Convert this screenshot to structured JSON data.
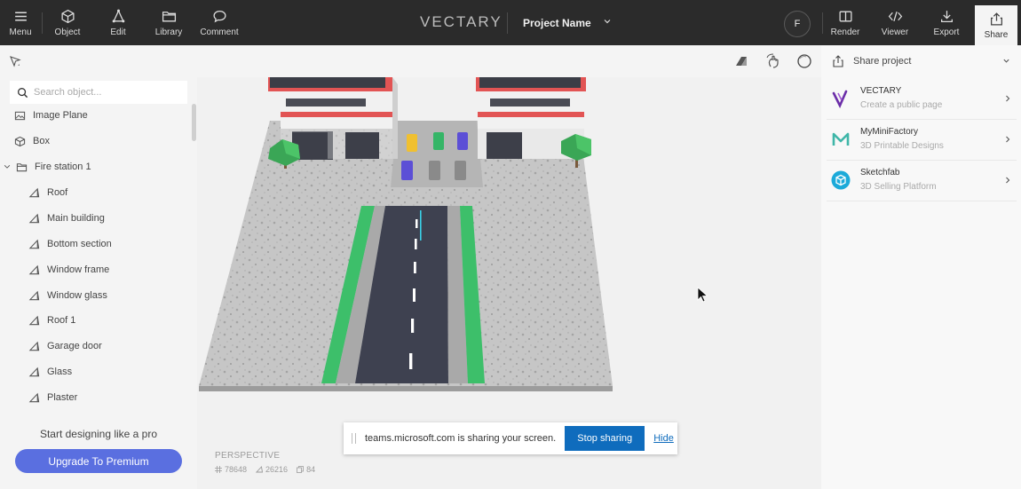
{
  "topbar": {
    "left_buttons": [
      {
        "label": "Menu",
        "icon": "hamburger-icon"
      },
      {
        "label": "Object",
        "icon": "cube-icon"
      },
      {
        "label": "Edit",
        "icon": "vertex-edit-icon"
      },
      {
        "label": "Library",
        "icon": "folder-icon"
      },
      {
        "label": "Comment",
        "icon": "speech-bubble-icon"
      }
    ],
    "logo": "VECTARY",
    "project_name": "Project Name",
    "avatar_initial": "F",
    "right_buttons": [
      {
        "label": "Render",
        "icon": "render-icon"
      },
      {
        "label": "Viewer",
        "icon": "code-icon"
      },
      {
        "label": "Export",
        "icon": "download-icon"
      },
      {
        "label": "Share",
        "icon": "share-icon"
      }
    ]
  },
  "left_panel": {
    "search_placeholder": "Search object...",
    "tree": [
      {
        "label": "Image Plane",
        "icon": "image-icon",
        "level": 0
      },
      {
        "label": "Box",
        "icon": "cube-icon",
        "level": 0
      },
      {
        "label": "Fire station 1",
        "icon": "folder-icon",
        "level": 0,
        "expanded": true
      },
      {
        "label": "Roof",
        "icon": "mesh-icon",
        "level": 1
      },
      {
        "label": "Main building",
        "icon": "mesh-icon",
        "level": 1
      },
      {
        "label": "Bottom section",
        "icon": "mesh-icon",
        "level": 1
      },
      {
        "label": "Window frame",
        "icon": "mesh-icon",
        "level": 1
      },
      {
        "label": "Window glass",
        "icon": "mesh-icon",
        "level": 1
      },
      {
        "label": "Roof 1",
        "icon": "mesh-icon",
        "level": 1
      },
      {
        "label": "Garage door",
        "icon": "mesh-icon",
        "level": 1
      },
      {
        "label": "Glass",
        "icon": "mesh-icon",
        "level": 1
      },
      {
        "label": "Plaster",
        "icon": "mesh-icon",
        "level": 1
      }
    ],
    "promo_text": "Start designing like a pro",
    "upgrade_label": "Upgrade To Premium"
  },
  "viewport": {
    "camera_label": "PERSPECTIVE",
    "stats": {
      "vertices": "78648",
      "polygons": "26216",
      "objects": "84"
    }
  },
  "share_bar": {
    "message": "teams.microsoft.com is sharing your screen.",
    "stop_label": "Stop sharing",
    "hide_label": "Hide"
  },
  "right_panel": {
    "title": "Share project",
    "services": [
      {
        "name": "VECTARY",
        "desc": "Create a public page",
        "icon": "vectary-logo-icon",
        "color": "#6b2ea8"
      },
      {
        "name": "MyMiniFactory",
        "desc": "3D Printable Designs",
        "icon": "myminifactory-logo-icon",
        "color": "#3fb6a8"
      },
      {
        "name": "Sketchfab",
        "desc": "3D Selling Platform",
        "icon": "sketchfab-logo-icon",
        "color": "#1caad9"
      }
    ]
  },
  "colors": {
    "accent": "#5a6fe0",
    "teams_blue": "#0f6cbd",
    "topbar": "#2b2b2b"
  }
}
